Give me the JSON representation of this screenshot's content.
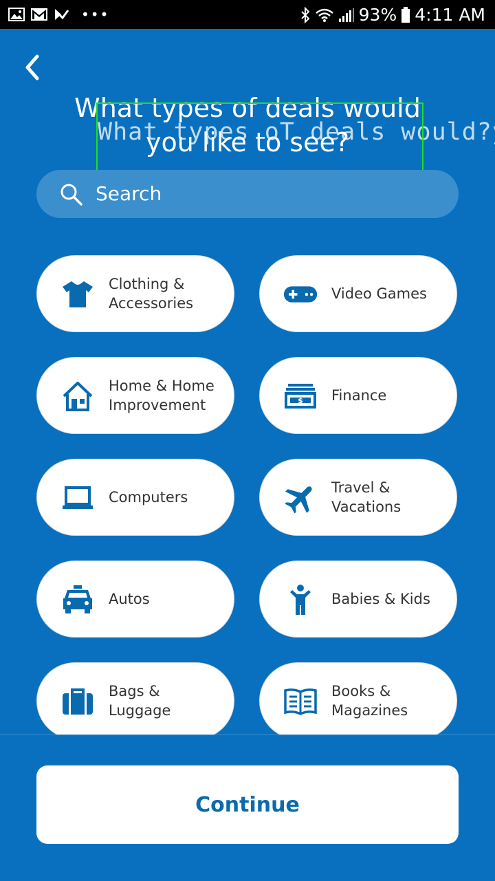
{
  "status_bar": {
    "battery": "93%",
    "time": "4:11 AM",
    "dots": "•••",
    "icons": [
      "gallery-icon",
      "gmail-icon",
      "check-icon",
      "bluetooth-icon",
      "wifi-icon",
      "signal-icon",
      "battery-icon"
    ]
  },
  "header": {
    "title": "What types of deals would you like to see?",
    "back_icon": "chevron-left-icon"
  },
  "overlay": {
    "text": "What types oT deals would?you",
    "label": "text_overlap",
    "color": "#22dd22"
  },
  "search": {
    "placeholder": "Search",
    "icon": "search-icon"
  },
  "categories": [
    {
      "label": "Clothing & Accessories",
      "icon": "tshirt-icon"
    },
    {
      "label": "Video Games",
      "icon": "gamepad-icon"
    },
    {
      "label": "Home & Home Improvement",
      "icon": "house-icon"
    },
    {
      "label": "Finance",
      "icon": "money-icon"
    },
    {
      "label": "Computers",
      "icon": "laptop-icon"
    },
    {
      "label": "Travel & Vacations",
      "icon": "airplane-icon"
    },
    {
      "label": "Autos",
      "icon": "car-icon"
    },
    {
      "label": "Babies & Kids",
      "icon": "child-icon"
    },
    {
      "label": "Bags & Luggage",
      "icon": "briefcase-icon"
    },
    {
      "label": "Books & Magazines",
      "icon": "book-icon"
    }
  ],
  "footer": {
    "continue_label": "Continue"
  },
  "colors": {
    "background": "#0870be",
    "icon": "#0a6aae",
    "button_text": "#0a6aae",
    "card": "#ffffff"
  }
}
